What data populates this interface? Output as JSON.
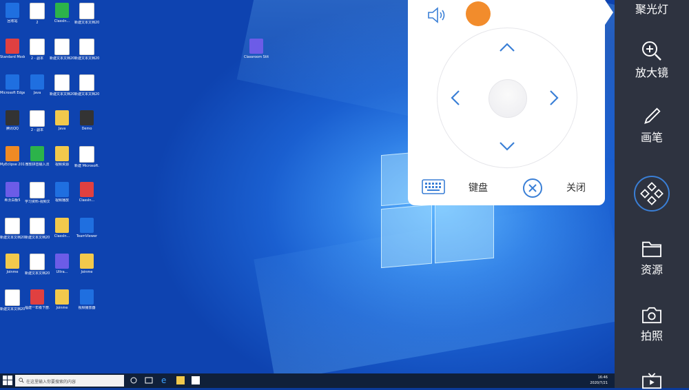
{
  "desktop": {
    "icons": [
      {
        "label": "回收站",
        "kind": "blue"
      },
      {
        "label": "2",
        "kind": "doc"
      },
      {
        "label": "ClassIn...",
        "kind": "green"
      },
      {
        "label": "新建文本文档2020071...",
        "kind": "doc"
      },
      {
        "label": "Standard Modes",
        "kind": "red"
      },
      {
        "label": "2 - 副本",
        "kind": "doc"
      },
      {
        "label": "新建文本文档2020071...",
        "kind": "doc"
      },
      {
        "label": "新建文本文档2020071...",
        "kind": "doc"
      },
      {
        "label": "Microsoft Edge",
        "kind": "blue"
      },
      {
        "label": "Java",
        "kind": "blue"
      },
      {
        "label": "新建文本文档2020071...",
        "kind": "doc"
      },
      {
        "label": "新建文本文档2020071...",
        "kind": "doc"
      },
      {
        "label": "腾讯QQ",
        "kind": "dark"
      },
      {
        "label": "2 - 副本",
        "kind": "doc"
      },
      {
        "label": "Java",
        "kind": "folder"
      },
      {
        "label": "Demo",
        "kind": "dark"
      },
      {
        "label": "MyEclipse 2017 CI",
        "kind": "orange"
      },
      {
        "label": "微软拼音输入法",
        "kind": "green"
      },
      {
        "label": "视频资源",
        "kind": "folder"
      },
      {
        "label": "新建 Microsoft...",
        "kind": "doc"
      },
      {
        "label": "希沃白板5",
        "kind": "purple"
      },
      {
        "label": "学习资料-视频文件...",
        "kind": "doc"
      },
      {
        "label": "视频播放",
        "kind": "blue"
      },
      {
        "label": "ClassIn...",
        "kind": "red"
      },
      {
        "label": "新建文本文档2020071...",
        "kind": "doc"
      },
      {
        "label": "新建文本文档2020071...",
        "kind": "doc"
      },
      {
        "label": "ClassIn...",
        "kind": "folder"
      },
      {
        "label": "TeamViewer",
        "kind": "blue"
      },
      {
        "label": "Joinme",
        "kind": "folder"
      },
      {
        "label": "新建文本文档2020071...",
        "kind": "doc"
      },
      {
        "label": "Ultra...",
        "kind": "purple"
      },
      {
        "label": "Joinme",
        "kind": "folder"
      },
      {
        "label": "新建文本文档2020071...",
        "kind": "doc"
      },
      {
        "label": "福建一年级下册...",
        "kind": "red"
      },
      {
        "label": "Joinme",
        "kind": "folder"
      },
      {
        "label": "视频播放器",
        "kind": "blue"
      },
      {
        "label": "Classroom Stitch",
        "kind": "purple"
      }
    ]
  },
  "taskbar": {
    "search_placeholder": "在这里输入你要搜索的内容",
    "time": "16:46",
    "date": "2020/7/21"
  },
  "panel": {
    "keyboard_label": "键盘",
    "close_label": "关闭"
  },
  "sidebar": {
    "spotlight": "聚光灯",
    "magnifier": "放大镜",
    "pen": "画笔",
    "resources": "资源",
    "photo": "拍照"
  },
  "colors": {
    "accent_blue": "#3a7fd6",
    "orange": "#f28c2c",
    "sidebar_bg": "#2e3340"
  }
}
